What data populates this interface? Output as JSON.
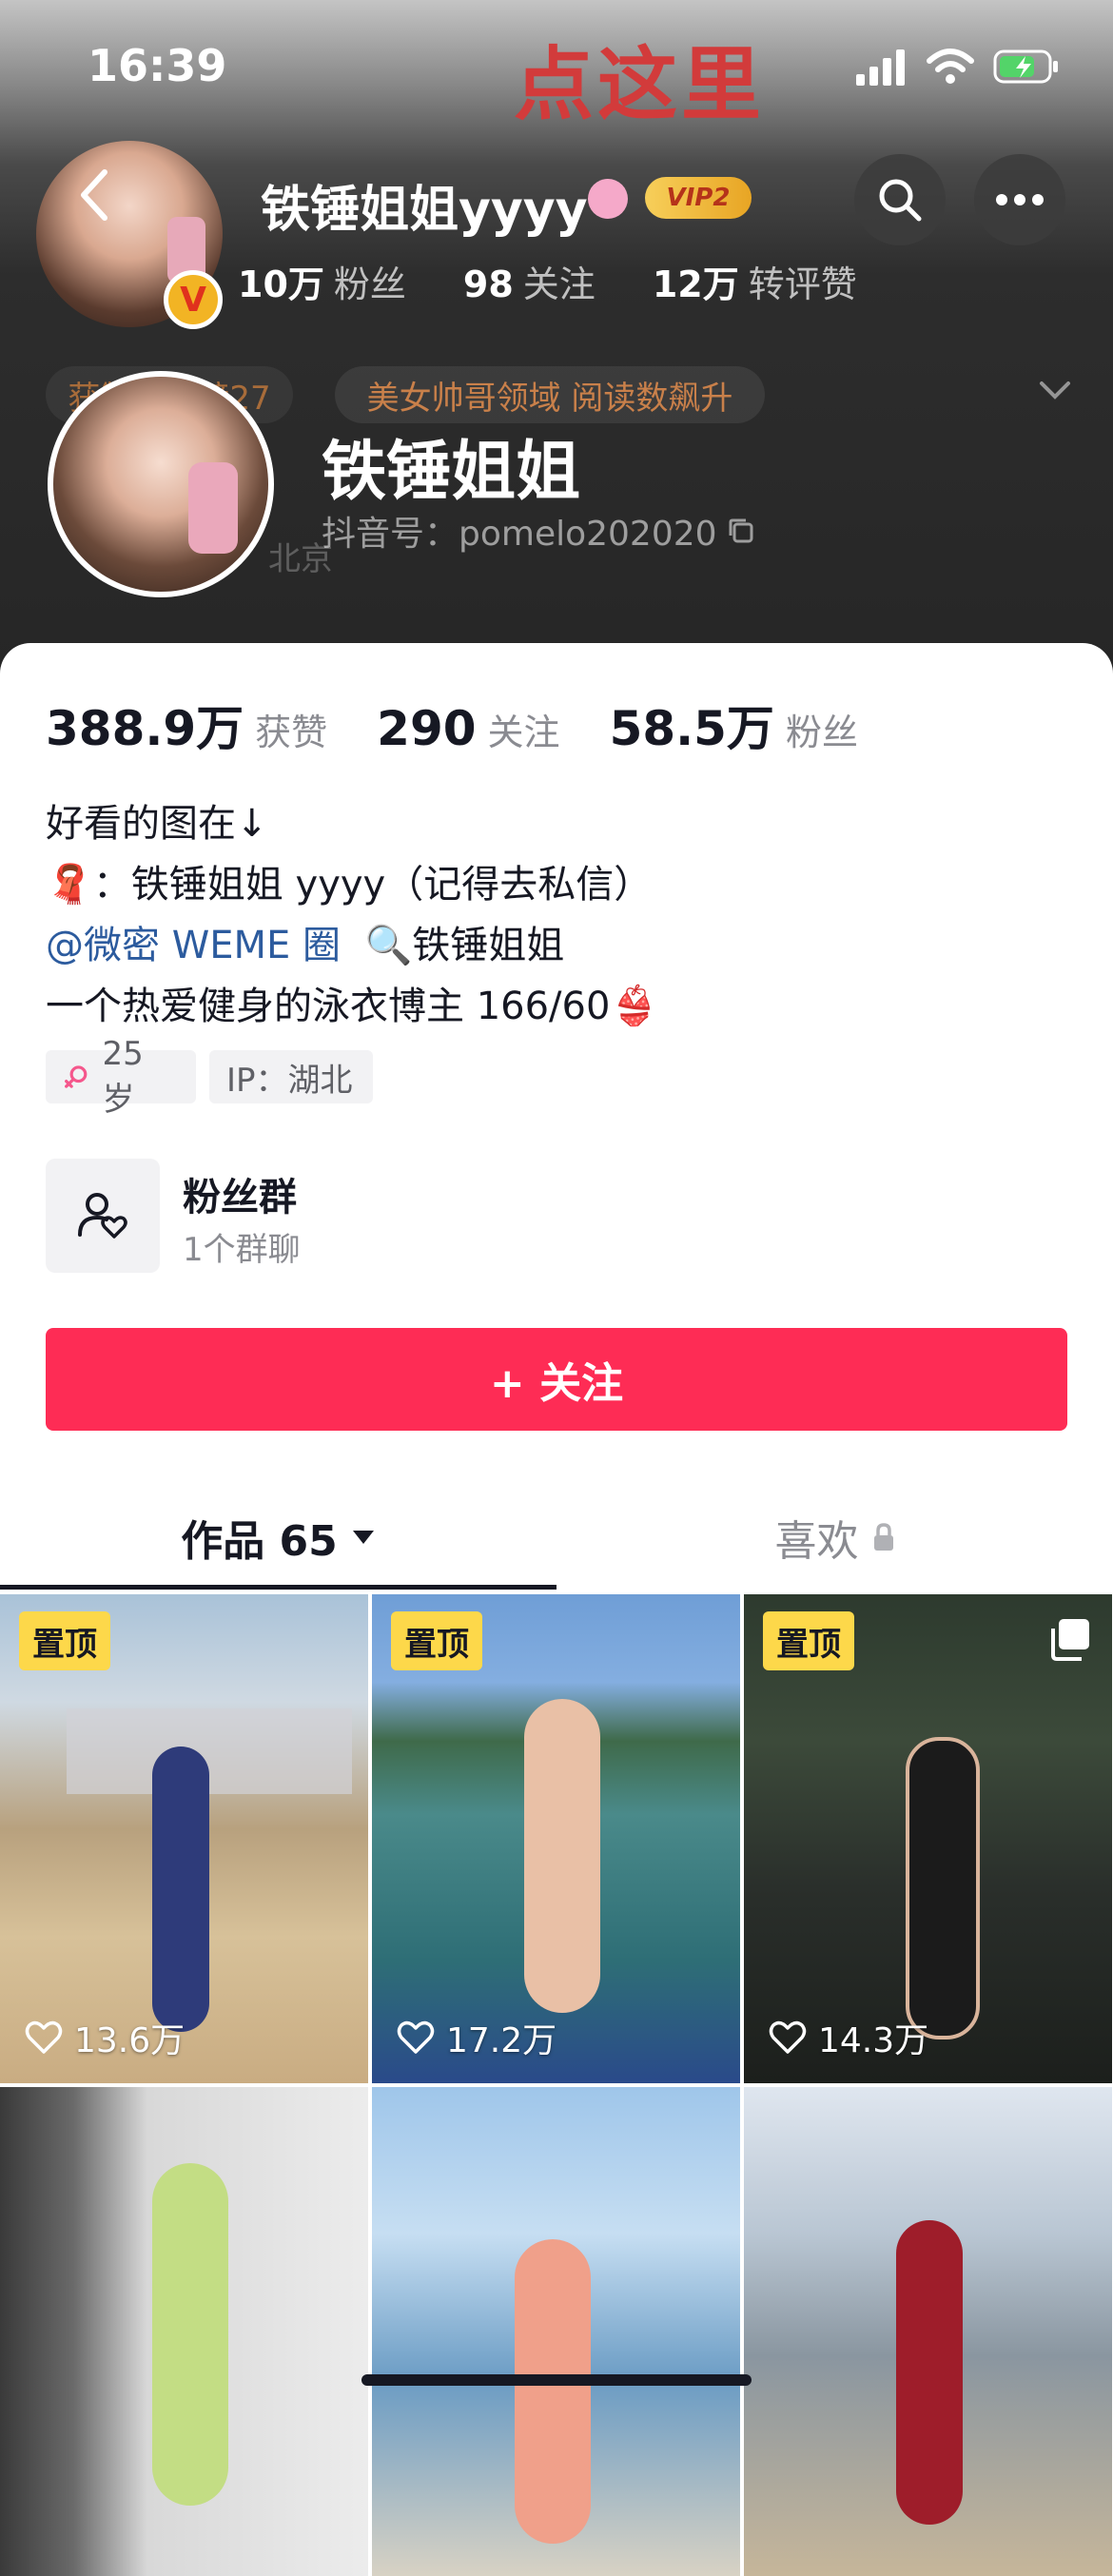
{
  "status_bar": {
    "time": "16:39",
    "banner": "点这里"
  },
  "header": {
    "nickname_top": "铁锤姐姐yyyy",
    "vip_label": "VIP2",
    "verified_mark": "V",
    "stats": [
      {
        "num": "10万",
        "label": "粉丝"
      },
      {
        "num": "98",
        "label": "关注"
      },
      {
        "num": "12万",
        "label": "转评赞"
      }
    ],
    "honor_text": "获赞达人榜27",
    "rank_text": "美女帅哥领域 阅读数飙升",
    "nickname": "铁锤姐姐",
    "douyin_id": "抖音号：pomelo202020",
    "location_faint": "北京"
  },
  "profile": {
    "stats": [
      {
        "num": "388.9万",
        "label": "获赞"
      },
      {
        "num": "290",
        "label": "关注"
      },
      {
        "num": "58.5万",
        "label": "粉丝"
      }
    ],
    "bio": {
      "line1": "好看的图在↓",
      "line2_icon": "🧣",
      "line2_text": "：铁锤姐姐 yyyy（记得去私信）",
      "line3_link": "@微密 WEME 圈",
      "line3_icon": "🔍",
      "line3_text": "铁锤姐姐",
      "line4": "一个热爱健身的泳衣博主 166/60",
      "line4_icon": "👙"
    },
    "tags": {
      "age": "25 岁",
      "ip": "IP：湖北"
    },
    "fan_group": {
      "title": "粉丝群",
      "subtitle": "1个群聊"
    },
    "follow_button": "+ 关注"
  },
  "tabs": {
    "works": "作品 65",
    "likes": "喜欢"
  },
  "videos": [
    {
      "pinned": "置顶",
      "likes": "13.6万"
    },
    {
      "pinned": "置顶",
      "likes": "17.2万"
    },
    {
      "pinned": "置顶",
      "likes": "14.3万"
    },
    {
      "pinned": "",
      "likes": ""
    },
    {
      "pinned": "",
      "likes": ""
    },
    {
      "pinned": "",
      "likes": ""
    }
  ],
  "colors": {
    "accent": "#fe2c55",
    "pin": "#fdd84a",
    "link": "#2c5b9e"
  }
}
